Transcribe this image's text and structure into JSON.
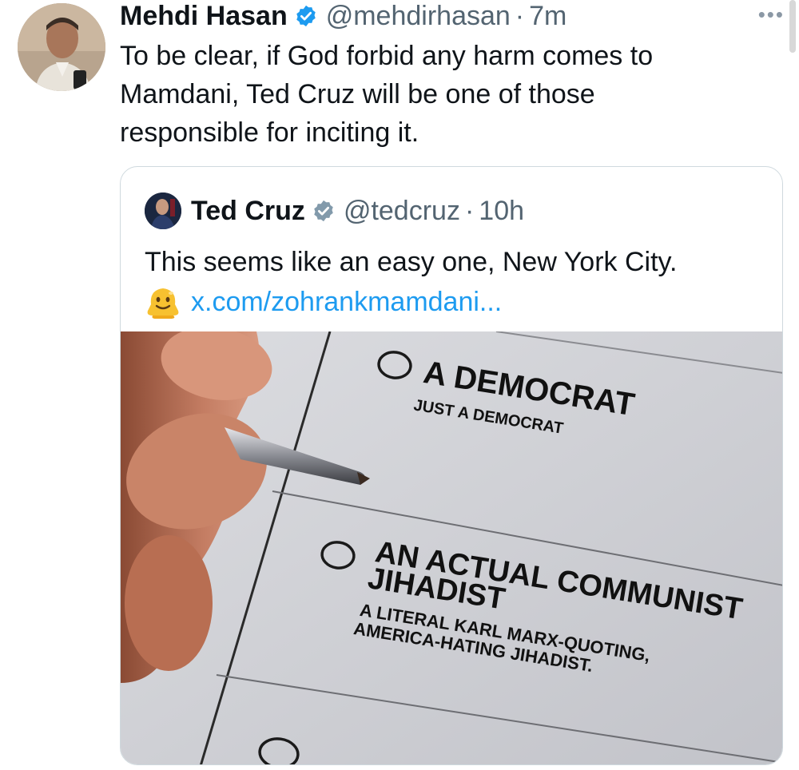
{
  "author": {
    "name": "Mehdi Hasan",
    "handle": "@mehdirhasan",
    "separator": "·",
    "time": "7m",
    "text": "To be clear, if God forbid any harm comes to Mamdani, Ted Cruz will be one of those responsible for inciting it."
  },
  "more_label": "•••",
  "quoted": {
    "name": "Ted Cruz",
    "handle": "@tedcruz",
    "separator": "·",
    "time": "10h",
    "text": "This seems like an easy one, New York City.",
    "emoji": "melting-face-emoji",
    "link": "x.com/zohrankmamdani..."
  },
  "ballot": {
    "option1_title": "A DEMOCRAT",
    "option1_sub": "JUST A DEMOCRAT",
    "option2_title_line1": "AN ACTUAL COMMUNIST",
    "option2_title_line2": "JIHADIST",
    "option2_sub_line1": "A LITERAL KARL MARX-QUOTING,",
    "option2_sub_line2": "AMERICA-HATING JIHADIST."
  },
  "colors": {
    "verified": "#1d9bf0",
    "verified_gray": "#829aab",
    "link": "#1d9bf0",
    "secondary_text": "#536471"
  }
}
